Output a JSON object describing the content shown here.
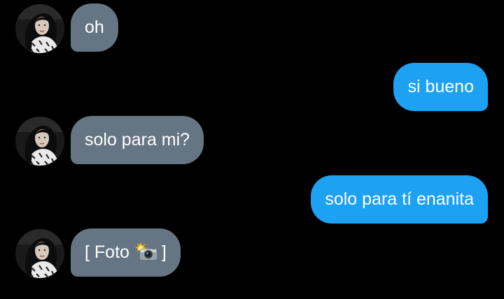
{
  "messages": [
    {
      "sender": "contact",
      "text": "oh"
    },
    {
      "sender": "me",
      "text": "si bueno"
    },
    {
      "sender": "contact",
      "text": "solo para mi?"
    },
    {
      "sender": "me",
      "text": "solo para tí enanita"
    },
    {
      "sender": "contact",
      "text_before": "[ Foto",
      "icon": "camera-flash-icon",
      "text_after": "]"
    }
  ],
  "colors": {
    "background": "#000000",
    "incoming_bubble": "#667583",
    "outgoing_bubble": "#1da1f2",
    "bubble_text": "#ffffff"
  }
}
